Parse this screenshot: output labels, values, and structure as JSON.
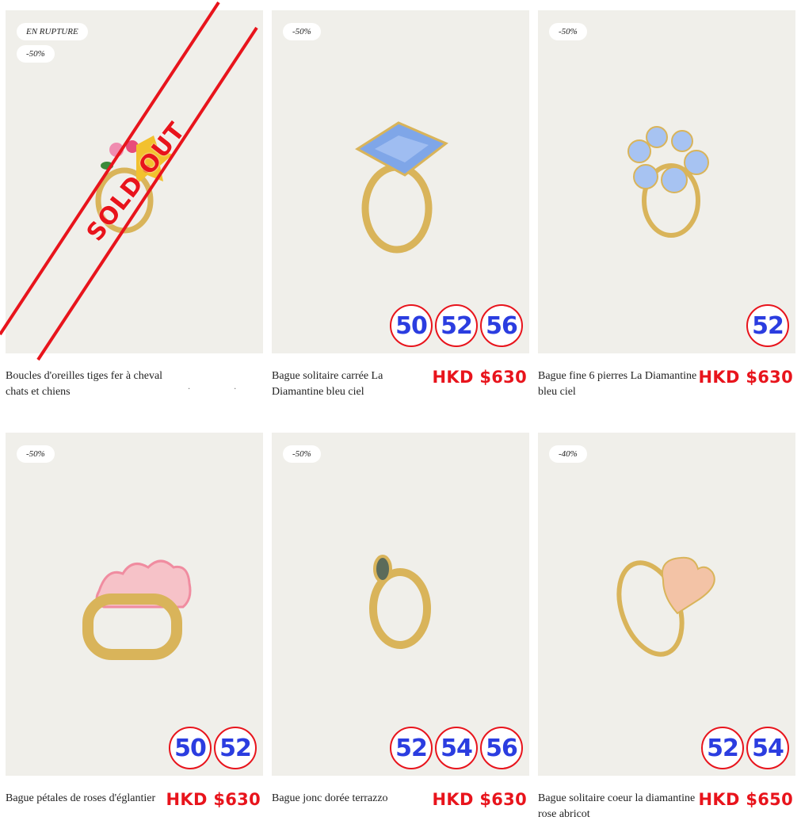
{
  "products": [
    {
      "name": "Boucles d'oreilles tiges fer à cheval chats et chiens",
      "out_of_stock_label": "EN RUPTURE",
      "discount": "-50%",
      "sold_out_label": "SOLD OUT",
      "price": "",
      "sizes": []
    },
    {
      "name": "Bague solitaire carrée La Diamantine bleu ciel",
      "discount": "-50%",
      "price": "HKD $630",
      "sizes": [
        "50",
        "52",
        "56"
      ]
    },
    {
      "name": "Bague fine 6 pierres La Diamantine bleu ciel",
      "discount": "-50%",
      "price": "HKD $630",
      "sizes": [
        "52"
      ]
    },
    {
      "name": "Bague pétales de roses d'églantier",
      "discount": "-50%",
      "price": "HKD $630",
      "sizes": [
        "50",
        "52"
      ]
    },
    {
      "name": "Bague jonc dorée terrazzo",
      "discount": "-50%",
      "price": "HKD $630",
      "sizes": [
        "52",
        "54",
        "56"
      ]
    },
    {
      "name": "Bague solitaire coeur la diamantine rose abricot",
      "discount": "-40%",
      "price": "HKD $650",
      "sizes": [
        "52",
        "54"
      ]
    }
  ],
  "colors": {
    "accent_red": "#e8141c",
    "size_blue": "#2b3de0",
    "card_bg": "#f0efea",
    "gold": "#d9b45a"
  }
}
